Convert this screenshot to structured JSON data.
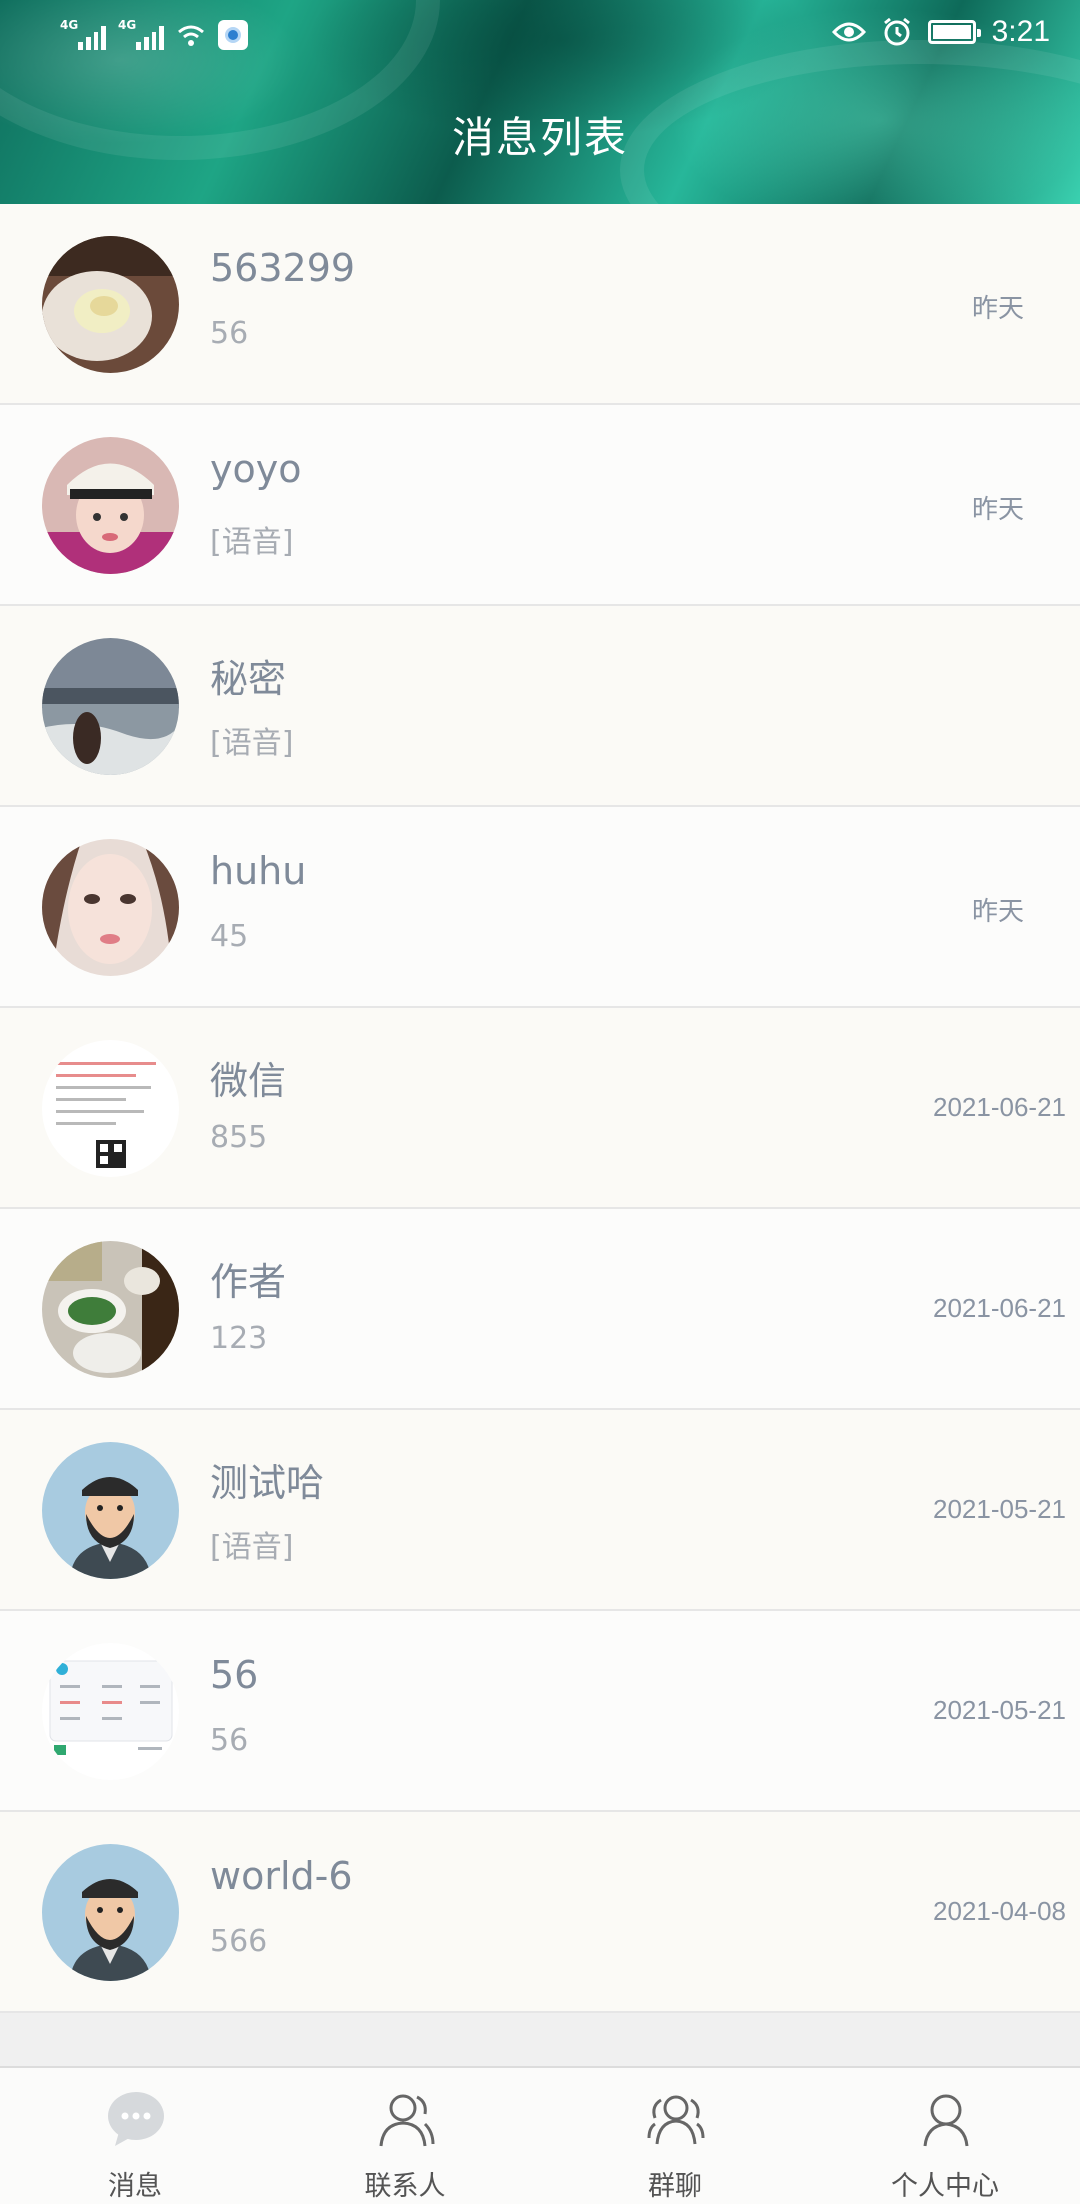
{
  "status_bar": {
    "signal1_tag": "4G",
    "signal2_tag": "4G",
    "time": "3:21"
  },
  "header": {
    "title": "消息列表"
  },
  "conversations": [
    {
      "name": "563299",
      "preview": "56",
      "time": "昨天"
    },
    {
      "name": "yoyo",
      "preview": "[语音]",
      "time": "昨天"
    },
    {
      "name": "秘密",
      "preview": "[语音]",
      "time": ""
    },
    {
      "name": "huhu",
      "preview": "45",
      "time": "昨天"
    },
    {
      "name": "微信",
      "preview": "855",
      "time": "2021-06-21"
    },
    {
      "name": "作者",
      "preview": "123",
      "time": "2021-06-21"
    },
    {
      "name": "测试哈",
      "preview": "[语音]",
      "time": "2021-05-21"
    },
    {
      "name": "56",
      "preview": "56",
      "time": "2021-05-21"
    },
    {
      "name": "world-6",
      "preview": "566",
      "time": "2021-04-08"
    }
  ],
  "tabbar": {
    "items": [
      {
        "label": "消息",
        "icon": "chat-bubble-icon",
        "active": true
      },
      {
        "label": "联系人",
        "icon": "contacts-icon"
      },
      {
        "label": "群聊",
        "icon": "group-icon"
      },
      {
        "label": "个人中心",
        "icon": "profile-icon"
      }
    ]
  },
  "colors": {
    "header_dark": "#0f6e5d",
    "header_light": "#3ad1b0",
    "name_text": "#7f8a99",
    "preview_text": "#a7acb3",
    "time_text": "#8a94a3"
  }
}
